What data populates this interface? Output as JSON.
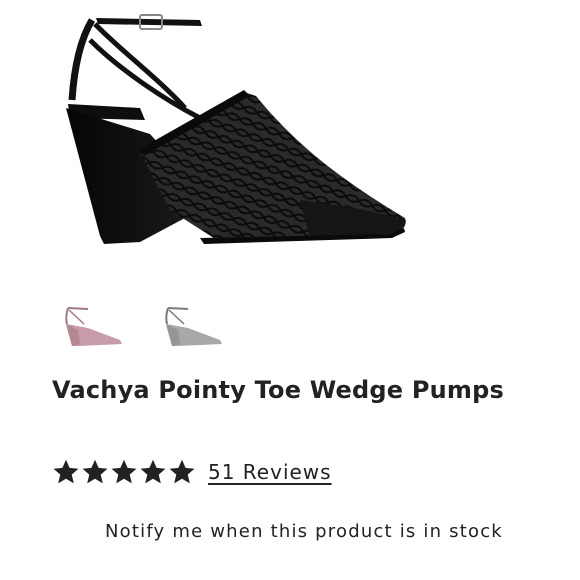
{
  "product": {
    "title": "Vachya Pointy Toe Wedge Pumps",
    "image_icon": "shoe-image",
    "swatch_colors": [
      "#c79ba7",
      "#a8a8a8"
    ],
    "main_color": "#111111"
  },
  "rating": {
    "stars": 5,
    "max_stars": 5,
    "reviews_label": "51 Reviews"
  },
  "stock": {
    "notify_text": "Notify me when this product is in stock"
  }
}
